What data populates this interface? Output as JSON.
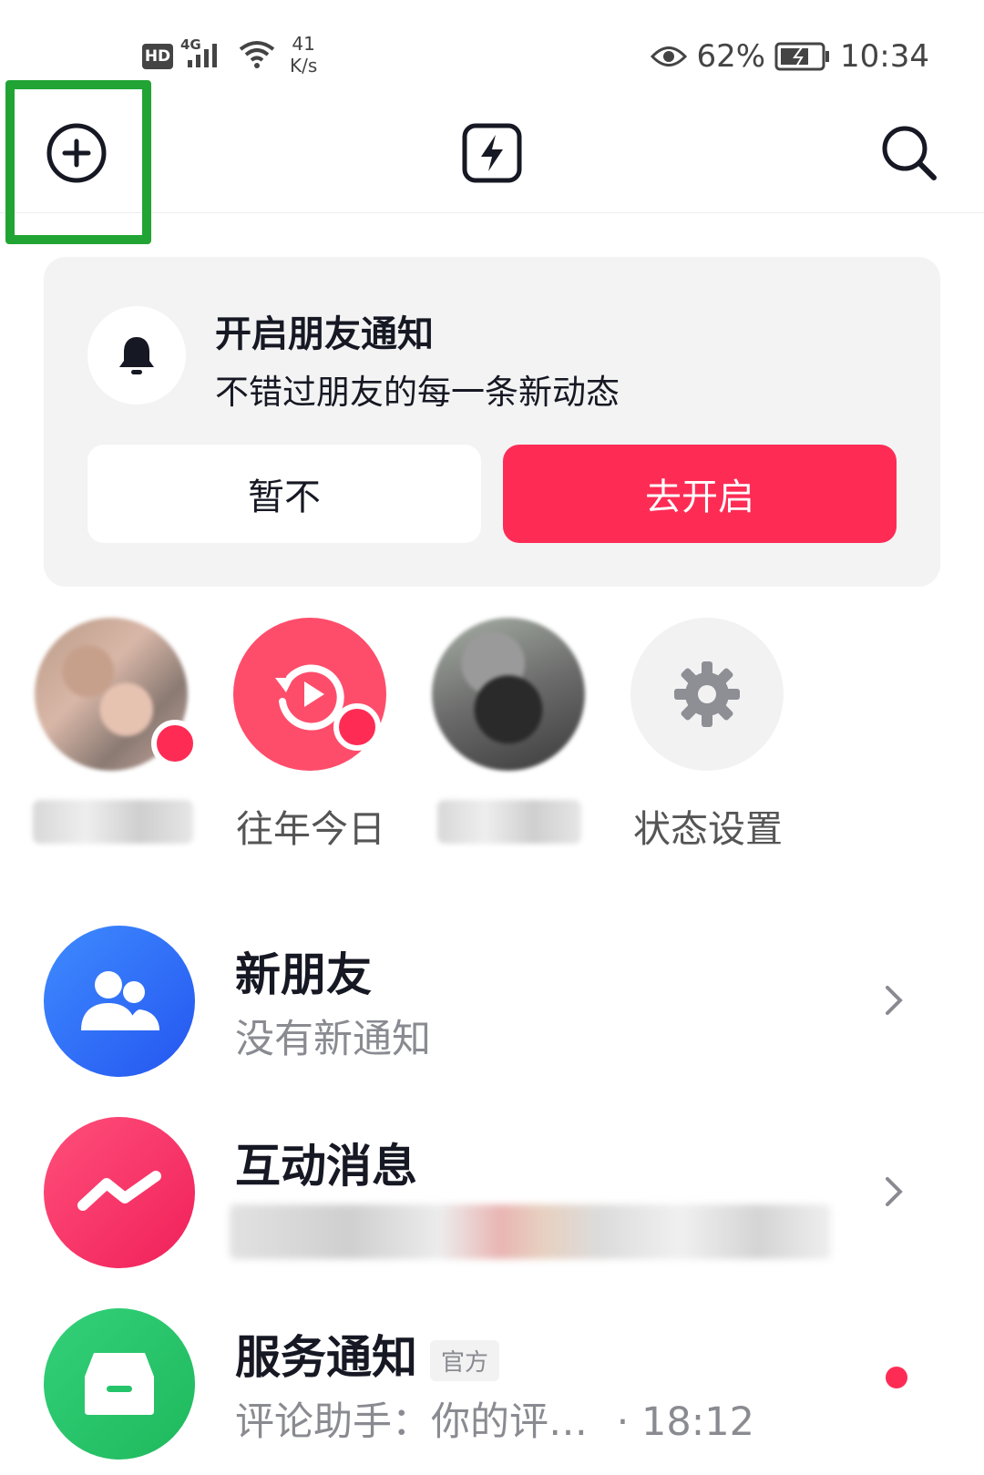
{
  "status_bar": {
    "hd": "HD",
    "network": "4G",
    "speed_value": "41",
    "speed_unit": "K/s",
    "battery": "62%",
    "time": "10:34"
  },
  "top_bar": {
    "left_icon": "add-circle-icon",
    "center_icon": "flash-icon",
    "right_icon": "search-icon"
  },
  "notice": {
    "title": "开启朋友通知",
    "subtitle": "不错过朋友的每一条新动态",
    "cancel_label": "暂不",
    "confirm_label": "去开启"
  },
  "stories": [
    {
      "label": "",
      "has_dot": true
    },
    {
      "label": "往年今日",
      "has_dot": true
    },
    {
      "label": "",
      "has_dot": false
    },
    {
      "label": "状态设置",
      "has_dot": false
    }
  ],
  "list": [
    {
      "title": "新朋友",
      "subtitle": "没有新通知"
    },
    {
      "title": "互动消息",
      "subtitle": ""
    },
    {
      "title": "服务通知",
      "tag": "官方",
      "subtitle": "评论助手：你的评…",
      "time": "· 18:12"
    }
  ],
  "colors": {
    "accent": "#fe2c55",
    "highlight": "#21a434",
    "blue": "#2f6bf5",
    "green": "#25c36a"
  }
}
